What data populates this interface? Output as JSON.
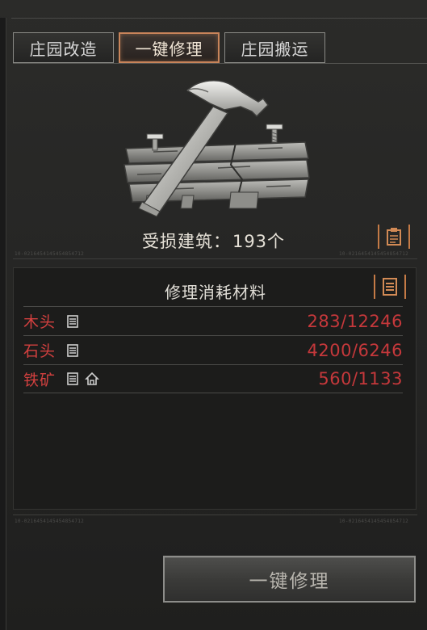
{
  "tabs": [
    {
      "label": "庄园改造",
      "active": false
    },
    {
      "label": "一键修理",
      "active": true
    },
    {
      "label": "庄园搬运",
      "active": false
    }
  ],
  "damaged": {
    "label": "受损建筑：",
    "count": "193",
    "unit": "个"
  },
  "materials": {
    "title": "修理消耗材料",
    "items": [
      {
        "name": "木头",
        "count": "283/12246",
        "icons": [
          "scroll-icon"
        ]
      },
      {
        "name": "石头",
        "count": "4200/6246",
        "icons": [
          "scroll-icon"
        ]
      },
      {
        "name": "铁矿",
        "count": "560/1133",
        "icons": [
          "scroll-icon",
          "house-icon"
        ]
      }
    ]
  },
  "repair_button": {
    "label": "一键修理"
  },
  "colors": {
    "accent": "#c8845a",
    "warning": "#c5383b",
    "text": "#e0ddd6"
  }
}
